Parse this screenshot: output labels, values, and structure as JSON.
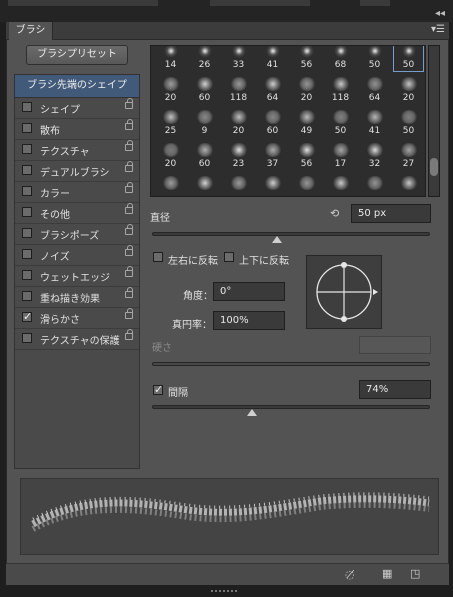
{
  "panel": {
    "tab_label": "ブラシ",
    "preset_button": "ブラシプリセット"
  },
  "sidebar": {
    "header": "ブラシ先端のシェイプ",
    "items": [
      {
        "label": "シェイプ",
        "checked": false,
        "locked": true
      },
      {
        "label": "散布",
        "checked": false,
        "locked": true
      },
      {
        "label": "テクスチャ",
        "checked": false,
        "locked": true
      },
      {
        "label": "デュアルブラシ",
        "checked": false,
        "locked": true
      },
      {
        "label": "カラー",
        "checked": false,
        "locked": true
      },
      {
        "label": "その他",
        "checked": false,
        "locked": true
      },
      {
        "label": "ブラシポーズ",
        "checked": false,
        "locked": true
      },
      {
        "label": "ノイズ",
        "checked": false,
        "locked": true
      },
      {
        "label": "ウェットエッジ",
        "checked": false,
        "locked": true
      },
      {
        "label": "重ね描き効果",
        "checked": false,
        "locked": true
      },
      {
        "label": "滑らかさ",
        "checked": true,
        "locked": true
      },
      {
        "label": "テクスチャの保護",
        "checked": false,
        "locked": true
      }
    ]
  },
  "brush_tips": {
    "sizes": [
      [
        "14",
        "26",
        "33",
        "41",
        "56",
        "68",
        "50",
        "50"
      ],
      [
        "20",
        "60",
        "118",
        "64",
        "20",
        "118",
        "64",
        "20"
      ],
      [
        "25",
        "9",
        "20",
        "60",
        "49",
        "50",
        "41",
        "50"
      ],
      [
        "20",
        "60",
        "23",
        "37",
        "56",
        "17",
        "32",
        "27"
      ],
      [
        "",
        "",
        "",
        "",
        "",
        "",
        "",
        ""
      ]
    ],
    "selected_row": 0,
    "selected_col": 7
  },
  "tip_shape": {
    "diameter_label": "直径",
    "diameter_value": "50 px",
    "diameter_level": 0.45,
    "flip_x_label": "左右に反転",
    "flip_y_label": "上下に反転",
    "angle_label": "角度：",
    "angle_value": "0°",
    "roundness_label": "真円率：",
    "roundness_value": "100%",
    "hardness_label": "硬さ",
    "spacing_label": "間隔",
    "spacing_checked": true,
    "spacing_value": "74%",
    "spacing_level": 0.36
  },
  "colors": {
    "selected_tab_bg": "#415a7a",
    "panel_bg": "#535353"
  }
}
